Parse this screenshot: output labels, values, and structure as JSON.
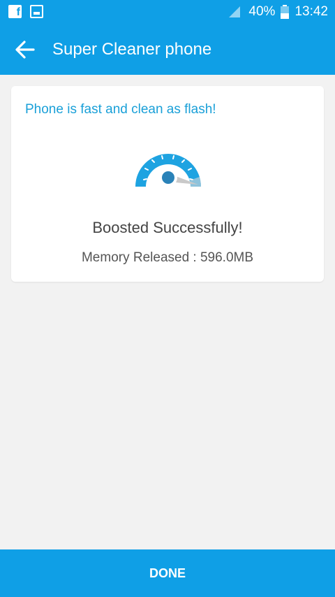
{
  "status_bar": {
    "battery": "40%",
    "time": "13:42",
    "icons": [
      "facebook-icon",
      "gallery-icon",
      "signal-icon",
      "battery-icon"
    ]
  },
  "app_bar": {
    "title": "Super Cleaner phone",
    "back_icon": "arrow-left-icon"
  },
  "result_card": {
    "headline": "Phone is fast and clean as flash!",
    "status": "Boosted Successfully!",
    "memory": "Memory Released : 596.0MB",
    "gauge_icon": "speedometer-icon"
  },
  "footer": {
    "done_label": "DONE"
  },
  "colors": {
    "primary": "#0f9fe6",
    "headline": "#1aa0d8",
    "background": "#f2f2f2"
  }
}
